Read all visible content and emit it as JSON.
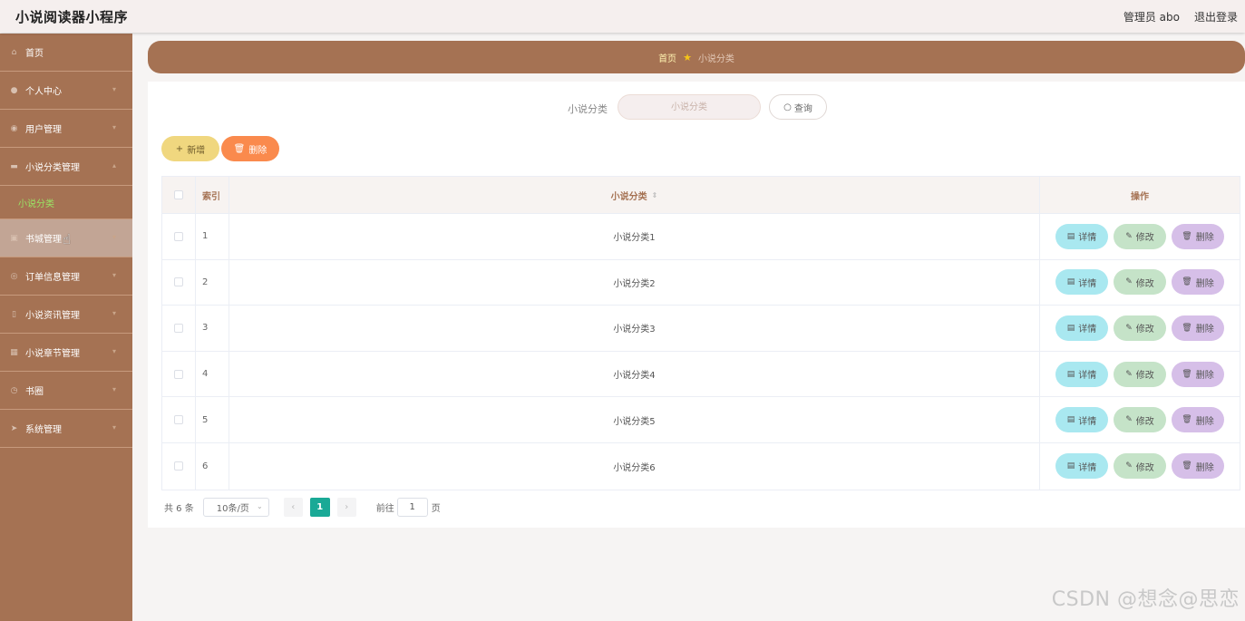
{
  "app": {
    "title": "小说阅读器小程序"
  },
  "topbar": {
    "admin": "管理员 abo",
    "logout": "退出登录"
  },
  "sidebar": {
    "items": [
      {
        "label": "首页",
        "icon": "home-icon"
      },
      {
        "label": "个人中心",
        "icon": "user-icon"
      },
      {
        "label": "用户管理",
        "icon": "location-icon"
      },
      {
        "label": "小说分类管理",
        "icon": "category-icon"
      },
      {
        "label": "书城管理",
        "icon": "book-icon"
      },
      {
        "label": "订单信息管理",
        "icon": "order-icon"
      },
      {
        "label": "小说资讯管理",
        "icon": "news-icon"
      },
      {
        "label": "小说章节管理",
        "icon": "chapter-icon"
      },
      {
        "label": "书圈",
        "icon": "circle-icon"
      },
      {
        "label": "系统管理",
        "icon": "settings-icon"
      }
    ],
    "sub_item": "小说分类"
  },
  "breadcrumb": {
    "home": "首页",
    "current": "小说分类"
  },
  "search": {
    "label": "小说分类",
    "placeholder": "小说分类",
    "button": "查询"
  },
  "actions": {
    "add": "新增",
    "delete": "删除"
  },
  "table": {
    "headers": {
      "index": "索引",
      "category": "小说分类",
      "ops": "操作"
    },
    "rows": [
      {
        "index": "1",
        "category": "小说分类1"
      },
      {
        "index": "2",
        "category": "小说分类2"
      },
      {
        "index": "3",
        "category": "小说分类3"
      },
      {
        "index": "4",
        "category": "小说分类4"
      },
      {
        "index": "5",
        "category": "小说分类5"
      },
      {
        "index": "6",
        "category": "小说分类6"
      }
    ],
    "ops": {
      "detail": "详情",
      "edit": "修改",
      "delete": "删除"
    }
  },
  "pagination": {
    "total": "共 6 条",
    "page_size": "10条/页",
    "current": "1",
    "goto": "前往",
    "goto_value": "1",
    "page_unit": "页"
  },
  "watermark": "CSDN @想念@思恋",
  "colors": {
    "sidebar": "#a57253",
    "add_button": "#f0d77f",
    "delete_button": "#fa8a4d",
    "detail": "#a9e8f0",
    "edit": "#c5e3c8",
    "row_delete": "#d6bfe8",
    "page_active": "#1aa996"
  }
}
